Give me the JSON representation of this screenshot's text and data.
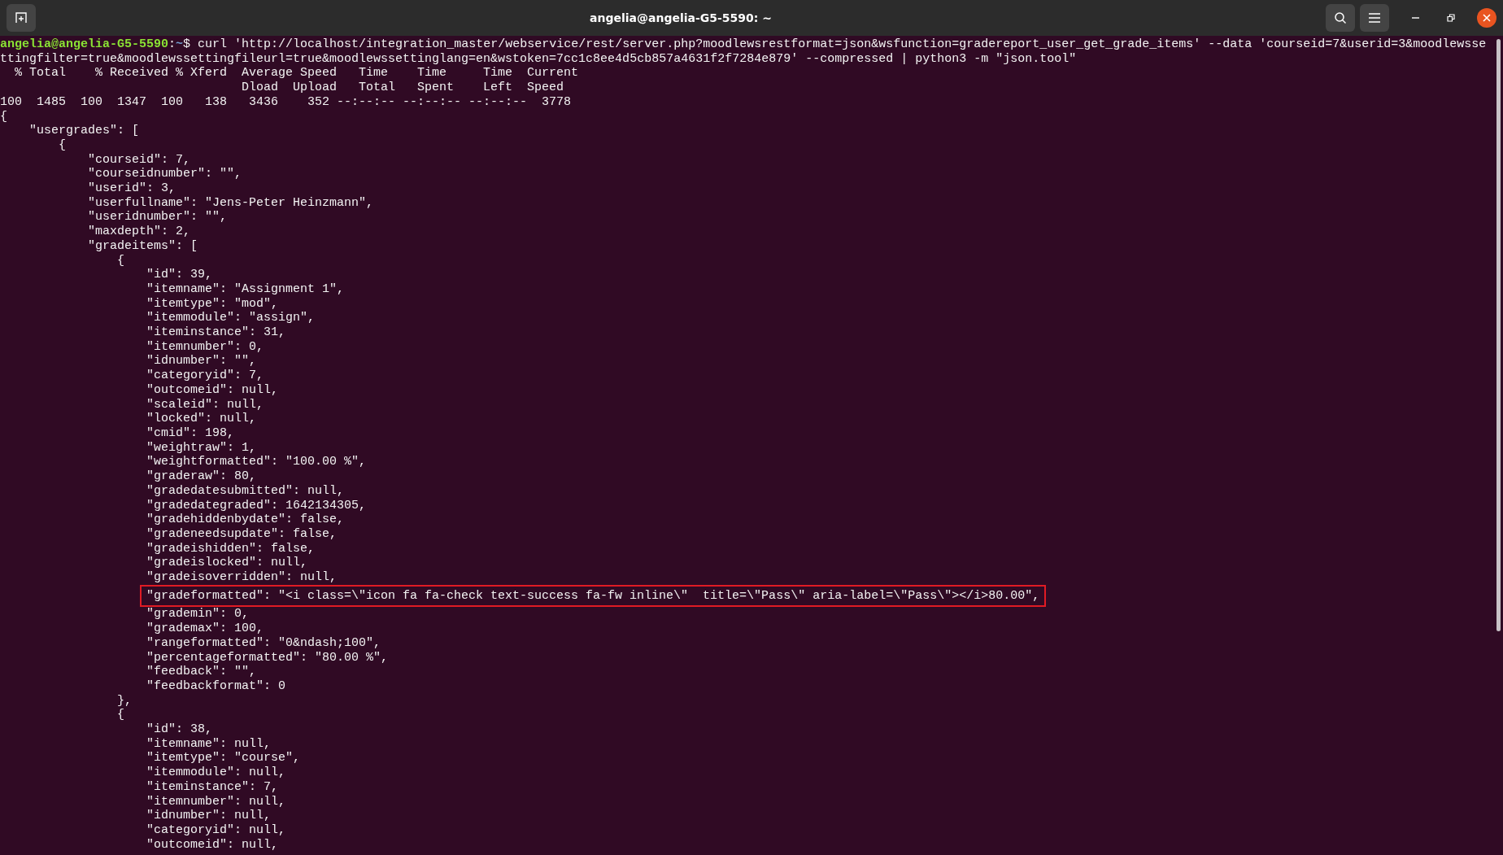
{
  "window": {
    "title": "angelia@angelia-G5-5590: ~"
  },
  "prompt": {
    "user_host": "angelia@angelia-G5-5590",
    "separator": ":",
    "path": "~",
    "symbol": "$",
    "command_lines": [
      "curl 'http://localhost/integration_master/webservice/rest/server.php?moodlewsrestformat=json&wsfunction=gradereport_user_get_grade_items' --data 'courseid=7&userid=3&moodlewsse",
      "ttingfilter=true&moodlewssettingfileurl=true&moodlewssettinglang=en&wstoken=7cc1c8ee4d5cb857a4631f2f7284e879' --compressed | python3 -m \"json.tool\""
    ]
  },
  "lines": [
    {
      "text": "  % Total    % Received % Xferd  Average Speed   Time    Time     Time  Current",
      "highlighted": false
    },
    {
      "text": "                                 Dload  Upload   Total   Spent    Left  Speed",
      "highlighted": false
    },
    {
      "text": "100  1485  100  1347  100   138   3436    352 --:--:-- --:--:-- --:--:--  3778",
      "highlighted": false
    },
    {
      "text": "{",
      "highlighted": false
    },
    {
      "text": "    \"usergrades\": [",
      "highlighted": false
    },
    {
      "text": "        {",
      "highlighted": false
    },
    {
      "text": "            \"courseid\": 7,",
      "highlighted": false
    },
    {
      "text": "            \"courseidnumber\": \"\",",
      "highlighted": false
    },
    {
      "text": "            \"userid\": 3,",
      "highlighted": false
    },
    {
      "text": "            \"userfullname\": \"Jens-Peter Heinzmann\",",
      "highlighted": false
    },
    {
      "text": "            \"useridnumber\": \"\",",
      "highlighted": false
    },
    {
      "text": "            \"maxdepth\": 2,",
      "highlighted": false
    },
    {
      "text": "            \"gradeitems\": [",
      "highlighted": false
    },
    {
      "text": "                {",
      "highlighted": false
    },
    {
      "text": "                    \"id\": 39,",
      "highlighted": false
    },
    {
      "text": "                    \"itemname\": \"Assignment 1\",",
      "highlighted": false
    },
    {
      "text": "                    \"itemtype\": \"mod\",",
      "highlighted": false
    },
    {
      "text": "                    \"itemmodule\": \"assign\",",
      "highlighted": false
    },
    {
      "text": "                    \"iteminstance\": 31,",
      "highlighted": false
    },
    {
      "text": "                    \"itemnumber\": 0,",
      "highlighted": false
    },
    {
      "text": "                    \"idnumber\": \"\",",
      "highlighted": false
    },
    {
      "text": "                    \"categoryid\": 7,",
      "highlighted": false
    },
    {
      "text": "                    \"outcomeid\": null,",
      "highlighted": false
    },
    {
      "text": "                    \"scaleid\": null,",
      "highlighted": false
    },
    {
      "text": "                    \"locked\": null,",
      "highlighted": false
    },
    {
      "text": "                    \"cmid\": 198,",
      "highlighted": false
    },
    {
      "text": "                    \"weightraw\": 1,",
      "highlighted": false
    },
    {
      "text": "                    \"weightformatted\": \"100.00 %\",",
      "highlighted": false
    },
    {
      "text": "                    \"graderaw\": 80,",
      "highlighted": false
    },
    {
      "text": "                    \"gradedatesubmitted\": null,",
      "highlighted": false
    },
    {
      "text": "                    \"gradedategraded\": 1642134305,",
      "highlighted": false
    },
    {
      "text": "                    \"gradehiddenbydate\": false,",
      "highlighted": false
    },
    {
      "text": "                    \"gradeneedsupdate\": false,",
      "highlighted": false
    },
    {
      "text": "                    \"gradeishidden\": false,",
      "highlighted": false
    },
    {
      "text": "                    \"gradeislocked\": null,",
      "highlighted": false
    },
    {
      "text": "                    \"gradeisoverridden\": null,",
      "highlighted": false
    },
    {
      "text": "                    \"gradeformatted\": \"<i class=\\\"icon fa fa-check text-success fa-fw inline\\\"  title=\\\"Pass\\\" aria-label=\\\"Pass\\\"></i>80.00\",",
      "highlighted": true
    },
    {
      "text": "                    \"grademin\": 0,",
      "highlighted": false
    },
    {
      "text": "                    \"grademax\": 100,",
      "highlighted": false
    },
    {
      "text": "                    \"rangeformatted\": \"0&ndash;100\",",
      "highlighted": false
    },
    {
      "text": "                    \"percentageformatted\": \"80.00 %\",",
      "highlighted": false
    },
    {
      "text": "                    \"feedback\": \"\",",
      "highlighted": false
    },
    {
      "text": "                    \"feedbackformat\": 0",
      "highlighted": false
    },
    {
      "text": "                },",
      "highlighted": false
    },
    {
      "text": "                {",
      "highlighted": false
    },
    {
      "text": "                    \"id\": 38,",
      "highlighted": false
    },
    {
      "text": "                    \"itemname\": null,",
      "highlighted": false
    },
    {
      "text": "                    \"itemtype\": \"course\",",
      "highlighted": false
    },
    {
      "text": "                    \"itemmodule\": null,",
      "highlighted": false
    },
    {
      "text": "                    \"iteminstance\": 7,",
      "highlighted": false
    },
    {
      "text": "                    \"itemnumber\": null,",
      "highlighted": false
    },
    {
      "text": "                    \"idnumber\": null,",
      "highlighted": false
    },
    {
      "text": "                    \"categoryid\": null,",
      "highlighted": false
    },
    {
      "text": "                    \"outcomeid\": null,",
      "highlighted": false
    }
  ]
}
